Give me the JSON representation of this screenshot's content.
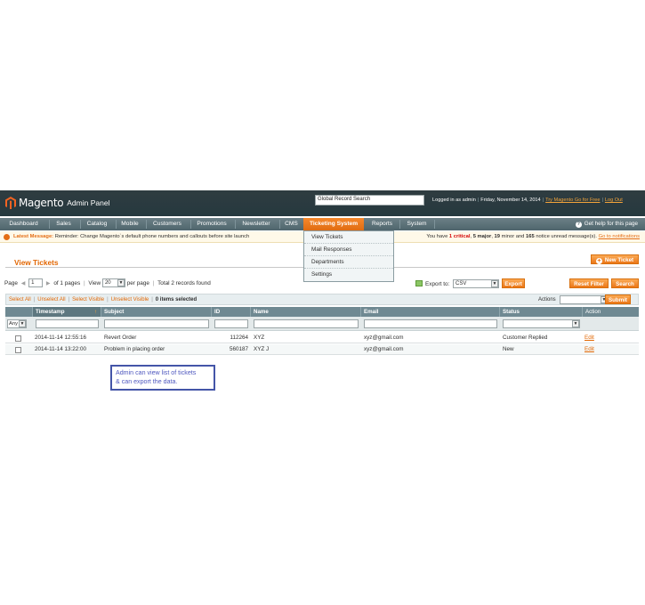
{
  "header": {
    "logo_text": "Magento",
    "logo_sub": "Admin Panel",
    "search_value": "Global Record Search",
    "logged_in": "Logged in as admin",
    "date": "Friday, November 14, 2014",
    "try_link": "Try Magento Go for Free",
    "logout": "Log Out",
    "brand_color": "#e26703"
  },
  "nav": {
    "items": [
      {
        "label": "Dashboard"
      },
      {
        "label": "Sales"
      },
      {
        "label": "Catalog"
      },
      {
        "label": "Mobile"
      },
      {
        "label": "Customers"
      },
      {
        "label": "Promotions"
      },
      {
        "label": "Newsletter"
      },
      {
        "label": "CMS"
      },
      {
        "label": "Ticketing System"
      },
      {
        "label": "Reports"
      },
      {
        "label": "System"
      }
    ],
    "active": "Ticketing System",
    "help": "Get help for this page"
  },
  "dropdown": {
    "items": [
      {
        "label": "View Tickets"
      },
      {
        "label": "Mail Responses"
      },
      {
        "label": "Departments"
      },
      {
        "label": "Settings"
      }
    ]
  },
  "message": {
    "label": "Latest Message:",
    "text": "Reminder: Change Magento`s default phone numbers and callouts before site launch",
    "right_prefix": "You have",
    "critical": "1 critical",
    "major": "5 major",
    "minor": "19",
    "minor_suffix": "minor and",
    "notice": "165",
    "notice_suffix": "notice unread message(s).",
    "link": "Go to notifications"
  },
  "page": {
    "title": "View Tickets",
    "new_ticket": "New Ticket"
  },
  "pager": {
    "page_label": "Page",
    "page_value": "1",
    "of_pages": "of 1 pages",
    "view_label": "View",
    "per_page_value": "20",
    "per_page_label": "per page",
    "total": "Total 2 records found",
    "export_label": "Export to:",
    "export_format": "CSV",
    "export_button": "Export",
    "reset_filter": "Reset Filter",
    "search": "Search"
  },
  "massaction": {
    "select_all": "Select All",
    "unselect_all": "Unselect All",
    "select_visible": "Select Visible",
    "unselect_visible": "Unselect Visible",
    "items_selected": "0 items selected",
    "actions_label": "Actions",
    "submit": "Submit"
  },
  "grid": {
    "columns": [
      "Timestamp",
      "Subject",
      "ID",
      "Name",
      "Email",
      "Status",
      "Action"
    ],
    "filter_any": "Any",
    "rows": [
      {
        "timestamp": "2014-11-14 12:55:16",
        "subject": "Revert Order",
        "id": "112264",
        "name": "XYZ",
        "email": "xyz@gmail.com",
        "status": "Customer Replied",
        "action": "Edit"
      },
      {
        "timestamp": "2014-11-14 13:22:00",
        "subject": "Problem in placing order",
        "id": "560187",
        "name": "XYZ J",
        "email": "xyz@gmail.com",
        "status": "New",
        "action": "Edit"
      }
    ]
  },
  "note": {
    "line1": "Admin can view list of tickets",
    "line2": "& can export the data."
  }
}
